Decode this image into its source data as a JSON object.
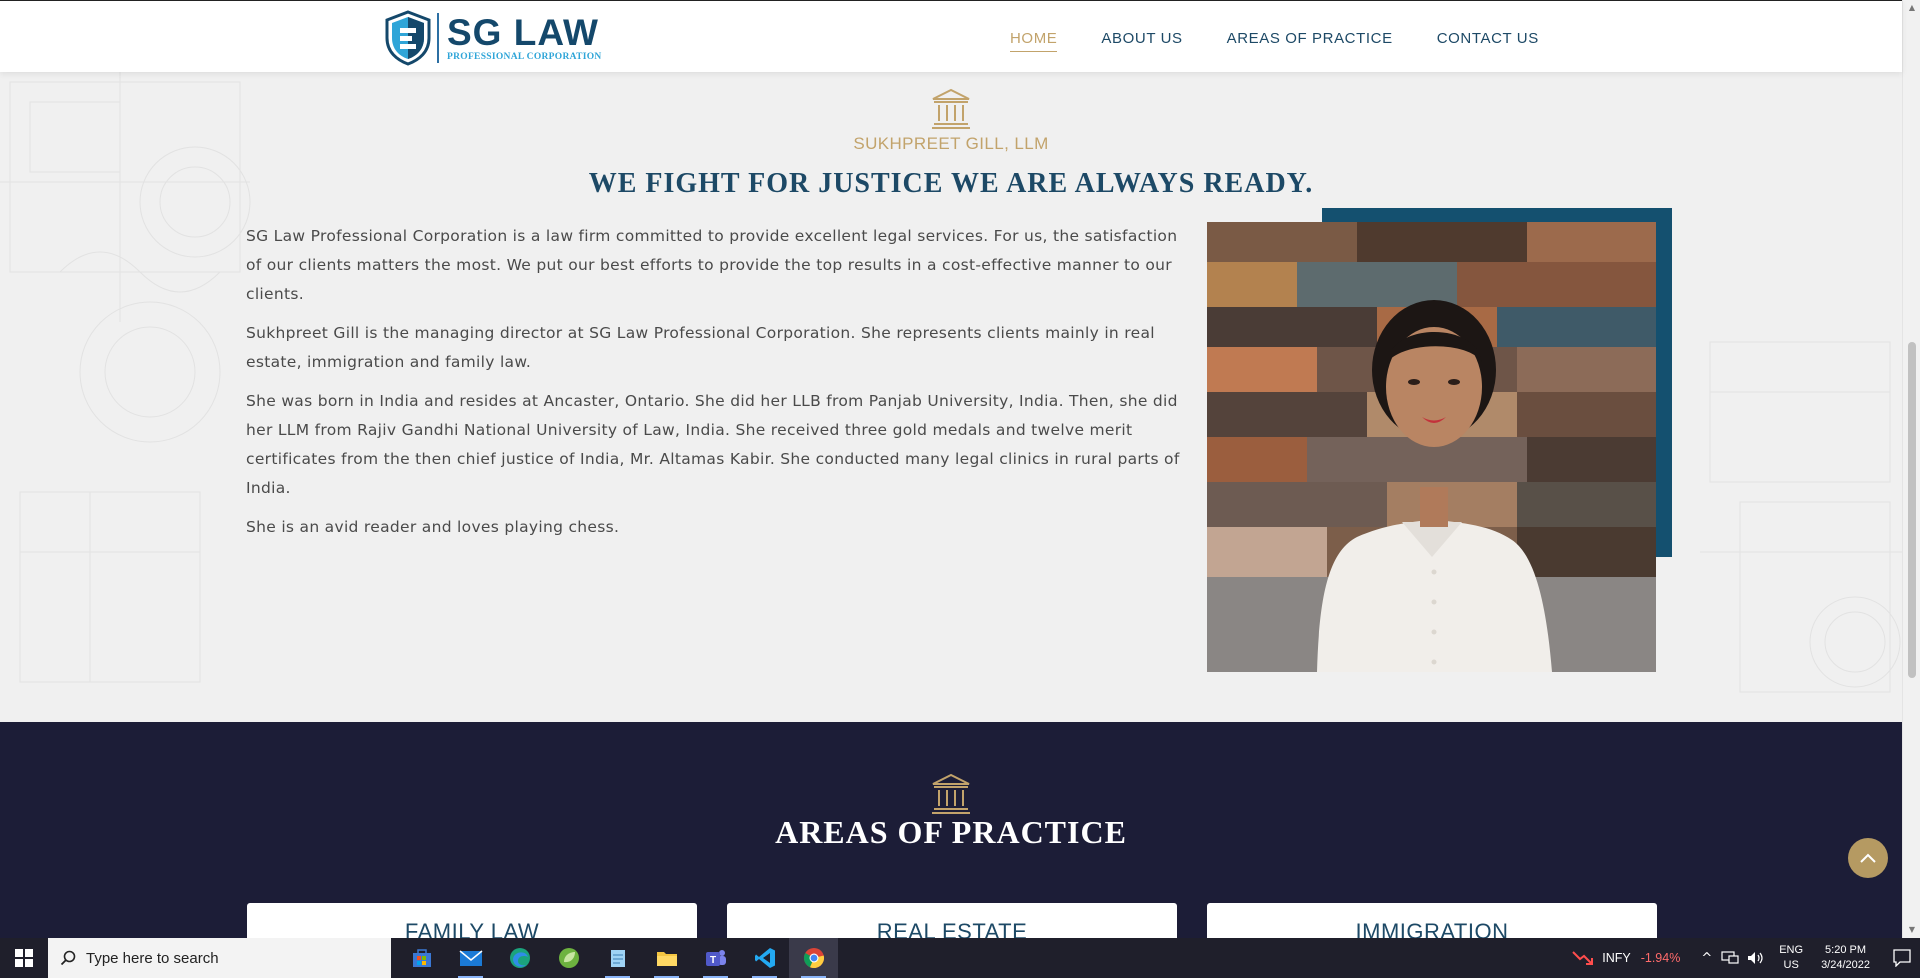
{
  "brand": {
    "name": "SG LAW",
    "subtitle": "PROFESSIONAL CORPORATION"
  },
  "nav": {
    "items": [
      {
        "label": "HOME",
        "active": true
      },
      {
        "label": "ABOUT US"
      },
      {
        "label": "AREAS OF PRACTICE"
      },
      {
        "label": "CONTACT US"
      }
    ]
  },
  "about": {
    "eyebrow": "SUKHPREET GILL, LLM",
    "title": "WE FIGHT FOR JUSTICE WE ARE ALWAYS READY.",
    "paragraphs": [
      "SG Law Professional Corporation is a law firm committed to provide excellent legal services. For us, the satisfaction of our clients matters the most. We put our best efforts to provide the top results in a cost-effective manner to our clients.",
      "Sukhpreet Gill is the managing director at SG Law Professional Corporation. She represents clients mainly in real estate, immigration and family law.",
      "She was born in India and resides at Ancaster, Ontario. She did her LLB from Panjab University, India. Then, she did her LLM from Rajiv Gandhi National University of Law, India. She received three gold medals and twelve merit certificates from the then chief justice of India, Mr. Altamas Kabir. She conducted many legal clinics in rural parts of India.",
      "She is an avid reader and loves playing chess."
    ]
  },
  "practice": {
    "title": "AREAS OF PRACTICE",
    "cards": [
      {
        "label": "FAMILY LAW"
      },
      {
        "label": "REAL ESTATE"
      },
      {
        "label": "IMMIGRATION"
      }
    ]
  },
  "taskbar": {
    "search_placeholder": "Type here to search",
    "stock_symbol": "INFY",
    "stock_change": "-1.94%",
    "lang_line1": "ENG",
    "lang_line2": "US",
    "time": "5:20 PM",
    "date": "3/24/2022"
  },
  "colors": {
    "navy": "#1d4966",
    "gold": "#c2a36b",
    "dark_section": "#1c1d37",
    "photo_accent": "#14506f"
  }
}
